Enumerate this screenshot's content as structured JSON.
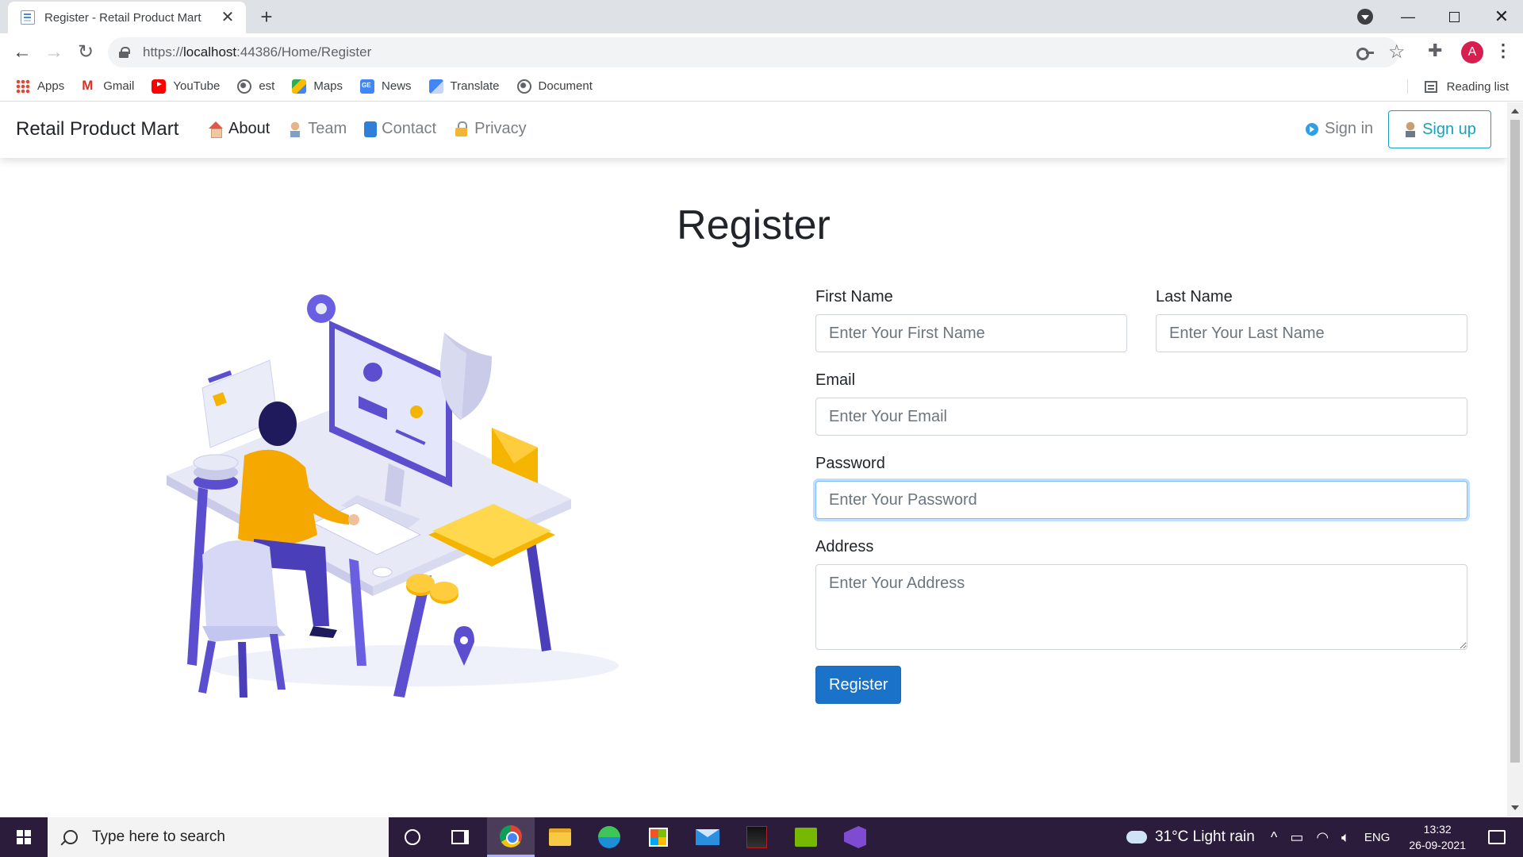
{
  "browser": {
    "tab_title": "Register - Retail Product Mart",
    "tab_close": "✕",
    "new_tab": "+",
    "url_prefix": "https://",
    "url_host": "localhost",
    "url_rest": ":44386/Home/Register",
    "avatar_letter": "A",
    "bookmarks": [
      {
        "label": "Apps",
        "icon": "apps-icon"
      },
      {
        "label": "Gmail",
        "icon": "gmail-icon"
      },
      {
        "label": "YouTube",
        "icon": "youtube-icon"
      },
      {
        "label": "est",
        "icon": "globe-icon"
      },
      {
        "label": "Maps",
        "icon": "maps-icon"
      },
      {
        "label": "News",
        "icon": "news-icon"
      },
      {
        "label": "Translate",
        "icon": "translate-icon"
      },
      {
        "label": "Document",
        "icon": "globe-icon"
      }
    ],
    "reading_list": "Reading list"
  },
  "navbar": {
    "brand": "Retail Product Mart",
    "links": [
      {
        "label": "About",
        "icon": "home-icon",
        "active": true
      },
      {
        "label": "Team",
        "icon": "team-icon",
        "active": false
      },
      {
        "label": "Contact",
        "icon": "contact-icon",
        "active": false
      },
      {
        "label": "Privacy",
        "icon": "lock-icon",
        "active": false
      }
    ],
    "sign_in": "Sign in",
    "sign_up": "Sign up"
  },
  "page": {
    "heading": "Register",
    "illustration": "person-at-computer-illustration"
  },
  "form": {
    "first_name": {
      "label": "First Name",
      "placeholder": "Enter Your First Name",
      "value": ""
    },
    "last_name": {
      "label": "Last Name",
      "placeholder": "Enter Your Last Name",
      "value": ""
    },
    "email": {
      "label": "Email",
      "placeholder": "Enter Your Email",
      "value": ""
    },
    "password": {
      "label": "Password",
      "placeholder": "Enter Your Password",
      "value": "",
      "focused": true
    },
    "address": {
      "label": "Address",
      "placeholder": "Enter Your Address",
      "value": ""
    },
    "submit": "Register"
  },
  "taskbar": {
    "search_placeholder": "Type here to search",
    "weather": "31°C  Light rain",
    "language": "ENG",
    "time": "13:32",
    "date": "26-09-2021"
  },
  "colors": {
    "primary_button": "#1a73c9",
    "sign_up_accent": "#17a2b8",
    "taskbar": "#2c1c3c",
    "illustration_purple": "#5b4fcf",
    "illustration_yellow": "#f5b400"
  }
}
